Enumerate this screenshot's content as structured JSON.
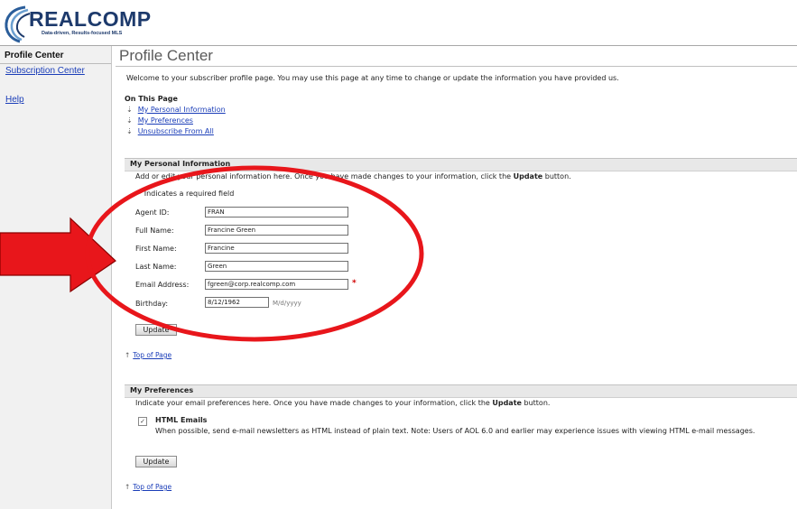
{
  "logo": {
    "brand": "REALCOMP",
    "tagline": "Data-driven, Results-focused MLS"
  },
  "sidebar": {
    "title": "Profile Center",
    "items": [
      {
        "label": "Subscription Center"
      },
      {
        "label": "Help"
      }
    ]
  },
  "main": {
    "title": "Profile Center",
    "welcome": "Welcome to your subscriber profile page. You may use this page at any time to change or update the information you have provided us.",
    "on_this_page": {
      "heading": "On This Page",
      "links": [
        "My Personal Information",
        "My Preferences",
        "Unsubscribe From All"
      ]
    },
    "personal": {
      "heading": "My Personal Information",
      "intro_before": "Add or edit your personal information here. Once you have made changes to your information, click the ",
      "intro_bold": "Update",
      "intro_after": " button.",
      "required_note": "Indicates a required field",
      "fields": [
        {
          "label": "Agent ID:",
          "value": "FRAN"
        },
        {
          "label": "Full Name:",
          "value": "Francine Green"
        },
        {
          "label": "First Name:",
          "value": "Francine"
        },
        {
          "label": "Last Name:",
          "value": "Green"
        },
        {
          "label": "Email Address:",
          "value": "fgreen@corp.realcomp.com"
        },
        {
          "label": "Birthday:",
          "value": "8/12/1962",
          "hint": "M/d/yyyy"
        }
      ],
      "update_label": "Update",
      "top_link": "Top of Page"
    },
    "preferences": {
      "heading": "My Preferences",
      "intro_before": "Indicate your email preferences here. Once you have made changes to your information, click the ",
      "intro_bold": "Update",
      "intro_after": " button.",
      "html_emails": {
        "label": "HTML Emails",
        "checked": true,
        "checkmark": "✓",
        "description": "When possible, send e-mail newsletters as HTML instead of plain text. Note: Users of AOL 6.0 and earlier may experience issues with viewing HTML e-mail messages."
      },
      "update_label": "Update",
      "top_link": "Top of Page"
    }
  },
  "colors": {
    "brand": "#1d3a6c",
    "link": "#1a3db8",
    "annotation": "#e8161b",
    "required": "#d10000"
  },
  "icons": {
    "anchor": "⇣",
    "up": "↑"
  }
}
